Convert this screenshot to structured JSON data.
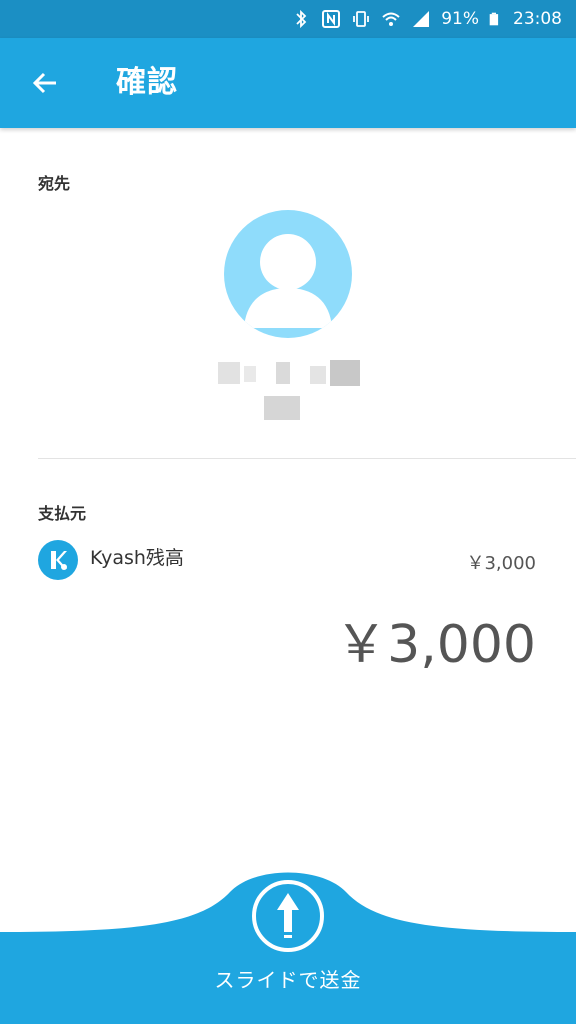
{
  "status_bar": {
    "battery": "91%",
    "time": "23:08",
    "icons": [
      "bluetooth-icon",
      "nfc-icon",
      "vibrate-icon",
      "wifi-icon",
      "signal-icon",
      "battery-icon"
    ]
  },
  "app_bar": {
    "back_icon": "arrow-back-icon",
    "title": "確認"
  },
  "recipient": {
    "label": "宛先",
    "avatar_icon": "person-icon"
  },
  "payment_source": {
    "label": "支払元",
    "logo_icon": "kyash-logo-icon",
    "name": "Kyash残高",
    "amount": "￥3,000"
  },
  "total": "￥3,000",
  "slide_action": {
    "icon": "arrow-up-icon",
    "label": "スライドで送金"
  },
  "colors": {
    "status_bar": "#1b8fc4",
    "primary": "#1fa6e0",
    "avatar_bg": "#8fdcfb"
  }
}
